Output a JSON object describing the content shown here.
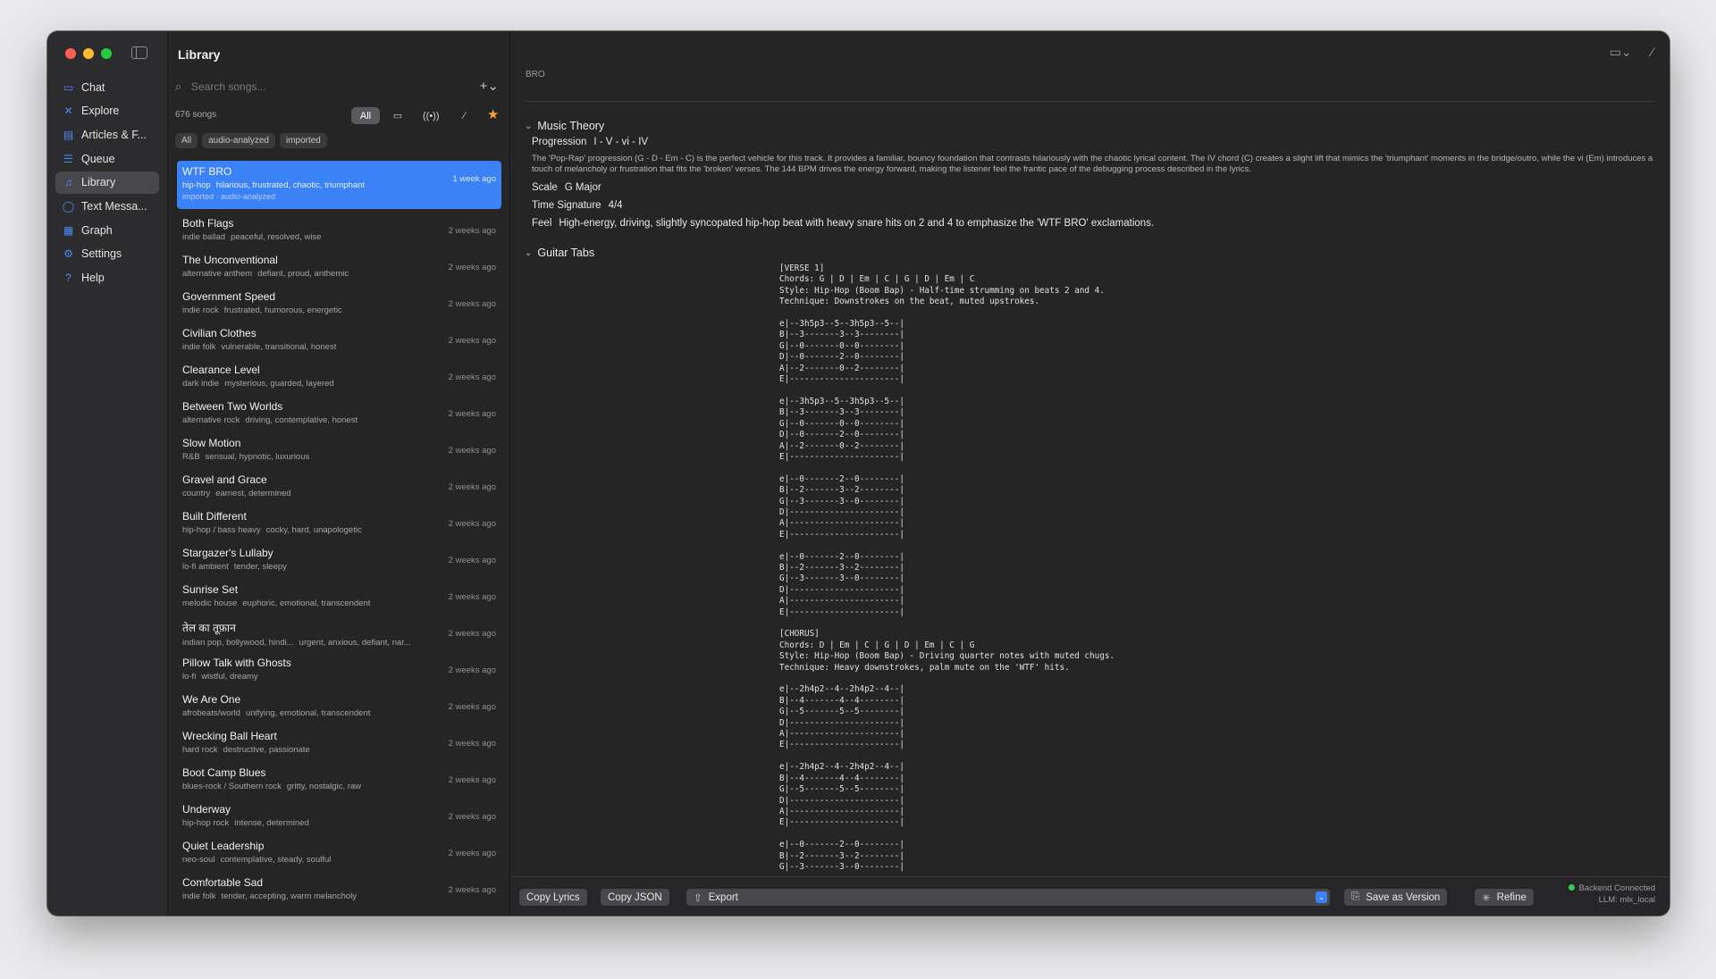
{
  "window": {
    "title": "Library"
  },
  "sidebar": {
    "items": [
      {
        "label": "Chat",
        "icon": "chat-icon",
        "glyph": "▭"
      },
      {
        "label": "Explore",
        "icon": "explore-icon",
        "glyph": "✕"
      },
      {
        "label": "Articles & F...",
        "icon": "articles-icon",
        "glyph": "▤"
      },
      {
        "label": "Queue",
        "icon": "queue-icon",
        "glyph": "☰"
      },
      {
        "label": "Library",
        "icon": "library-icon",
        "glyph": "♫"
      },
      {
        "label": "Text Messa...",
        "icon": "message-icon",
        "glyph": "◯"
      },
      {
        "label": "Graph",
        "icon": "graph-icon",
        "glyph": "▦"
      },
      {
        "label": "Settings",
        "icon": "gear-icon",
        "glyph": "⚙"
      },
      {
        "label": "Help",
        "icon": "help-icon",
        "glyph": "?"
      }
    ],
    "active_index": 4
  },
  "list": {
    "search_placeholder": "Search songs...",
    "count": "676 songs",
    "filters": [
      "All",
      "▭",
      "((•))",
      "⁄"
    ],
    "chips": [
      "All",
      "audio-analyzed",
      "imported"
    ],
    "songs": [
      {
        "title": "WTF BRO",
        "genre": "hip-hop",
        "tags": "hilarious, frustrated, chaotic, triumphant",
        "time": "1 week ago",
        "sub": "imported · audio-analyzed",
        "selected": true
      },
      {
        "title": "Both Flags",
        "genre": "indie ballad",
        "tags": "peaceful, resolved, wise",
        "time": "2 weeks ago"
      },
      {
        "title": "The Unconventional",
        "genre": "alternative anthem",
        "tags": "defiant, proud, anthemic",
        "time": "2 weeks ago"
      },
      {
        "title": "Government Speed",
        "genre": "indie rock",
        "tags": "frustrated, humorous, energetic",
        "time": "2 weeks ago"
      },
      {
        "title": "Civilian Clothes",
        "genre": "indie folk",
        "tags": "vulnerable, transitional, honest",
        "time": "2 weeks ago"
      },
      {
        "title": "Clearance Level",
        "genre": "dark indie",
        "tags": "mysterious, guarded, layered",
        "time": "2 weeks ago"
      },
      {
        "title": "Between Two Worlds",
        "genre": "alternative rock",
        "tags": "driving, contemplative, honest",
        "time": "2 weeks ago"
      },
      {
        "title": "Slow Motion",
        "genre": "R&B",
        "tags": "sensual, hypnotic, luxurious",
        "time": "2 weeks ago"
      },
      {
        "title": "Gravel and Grace",
        "genre": "country",
        "tags": "earnest, determined",
        "time": "2 weeks ago"
      },
      {
        "title": "Built Different",
        "genre": "hip-hop / bass heavy",
        "tags": "cocky, hard, unapologetic",
        "time": "2 weeks ago"
      },
      {
        "title": "Stargazer's Lullaby",
        "genre": "lo-fi ambient",
        "tags": "tender, sleepy",
        "time": "2 weeks ago"
      },
      {
        "title": "Sunrise Set",
        "genre": "melodic house",
        "tags": "euphoric, emotional, transcendent",
        "time": "2 weeks ago"
      },
      {
        "title": "तेल का तूफ़ान",
        "genre": "indian pop, bollywood, hindi...",
        "tags": "urgent, anxious, defiant, nar...",
        "time": "2 weeks ago"
      },
      {
        "title": "Pillow Talk with Ghosts",
        "genre": "lo-fi",
        "tags": "wistful, dreamy",
        "time": "2 weeks ago"
      },
      {
        "title": "We Are One",
        "genre": "afrobeats/world",
        "tags": "unifying, emotional, transcendent",
        "time": "2 weeks ago"
      },
      {
        "title": "Wrecking Ball Heart",
        "genre": "hard rock",
        "tags": "destructive, passionate",
        "time": "2 weeks ago"
      },
      {
        "title": "Boot Camp Blues",
        "genre": "blues-rock / Southern rock",
        "tags": "gritty, nostalgic, raw",
        "time": "2 weeks ago"
      },
      {
        "title": "Underway",
        "genre": "hip-hop rock",
        "tags": "intense, determined",
        "time": "2 weeks ago"
      },
      {
        "title": "Quiet Leadership",
        "genre": "neo-soul",
        "tags": "contemplative, steady, soulful",
        "time": "2 weeks ago"
      },
      {
        "title": "Comfortable Sad",
        "genre": "indie folk",
        "tags": "tender, accepting, warm melancholy",
        "time": "2 weeks ago"
      }
    ]
  },
  "detail": {
    "cut_text": "BRO",
    "music_theory": {
      "heading": "Music Theory",
      "progression_label": "Progression",
      "progression_value": "I - V - vi - IV",
      "description": "The 'Pop-Rap' progression (G - D - Em - C) is the perfect vehicle for this track. It provides a familiar, bouncy foundation that contrasts hilariously with the chaotic lyrical content. The IV chord (C) creates a slight lift that mimics the 'triumphant' moments in the bridge/outro, while the vi (Em) introduces a touch of melancholy or frustration that fits the 'broken' verses. The 144 BPM drives the energy forward, making the listener feel the frantic pace of the debugging process described in the lyrics.",
      "scale_label": "Scale",
      "scale_value": "G Major",
      "ts_label": "Time Signature",
      "ts_value": "4/4",
      "feel_label": "Feel",
      "feel_value": "High-energy, driving, slightly syncopated hip-hop beat with heavy snare hits on 2 and 4 to emphasize the 'WTF BRO' exclamations."
    },
    "guitar_tabs": {
      "heading": "Guitar Tabs",
      "text": "[VERSE 1]\nChords: G | D | Em | C | G | D | Em | C\nStyle: Hip-Hop (Boom Bap) - Half-time strumming on beats 2 and 4.\nTechnique: Downstrokes on the beat, muted upstrokes.\n\ne|--3h5p3--5--3h5p3--5--|\nB|--3-------3--3--------|\nG|--0-------0--0--------|\nD|--0-------2--0--------|\nA|--2-------0--2--------|\nE|----------------------|\n\ne|--3h5p3--5--3h5p3--5--|\nB|--3-------3--3--------|\nG|--0-------0--0--------|\nD|--0-------2--0--------|\nA|--2-------0--2--------|\nE|----------------------|\n\ne|--0-------2--0--------|\nB|--2-------3--2--------|\nG|--3-------3--0--------|\nD|----------------------|\nA|----------------------|\nE|----------------------|\n\ne|--0-------2--0--------|\nB|--2-------3--2--------|\nG|--3-------3--0--------|\nD|----------------------|\nA|----------------------|\nE|----------------------|\n\n[CHORUS]\nChords: D | Em | C | G | D | Em | C | G\nStyle: Hip-Hop (Boom Bap) - Driving quarter notes with muted chugs.\nTechnique: Heavy downstrokes, palm mute on the 'WTF' hits.\n\ne|--2h4p2--4--2h4p2--4--|\nB|--4-------4--4--------|\nG|--5-------5--5--------|\nD|----------------------|\nA|----------------------|\nE|----------------------|\n\ne|--2h4p2--4--2h4p2--4--|\nB|--4-------4--4--------|\nG|--5-------5--5--------|\nD|----------------------|\nA|----------------------|\nE|----------------------|\n\ne|--0-------2--0--------|\nB|--2-------3--2--------|\nG|--3-------3--0--------|"
    }
  },
  "bottom": {
    "copy_lyrics": "Copy Lyrics",
    "copy_json": "Copy JSON",
    "export": "Export",
    "save_version": "Save as Version",
    "refine": "Refine",
    "status": "Backend Connected",
    "llm": "LLM: mlx_local"
  },
  "colors": {
    "accent": "#3b82f6",
    "star": "#f2a535",
    "connected": "#30d158"
  }
}
